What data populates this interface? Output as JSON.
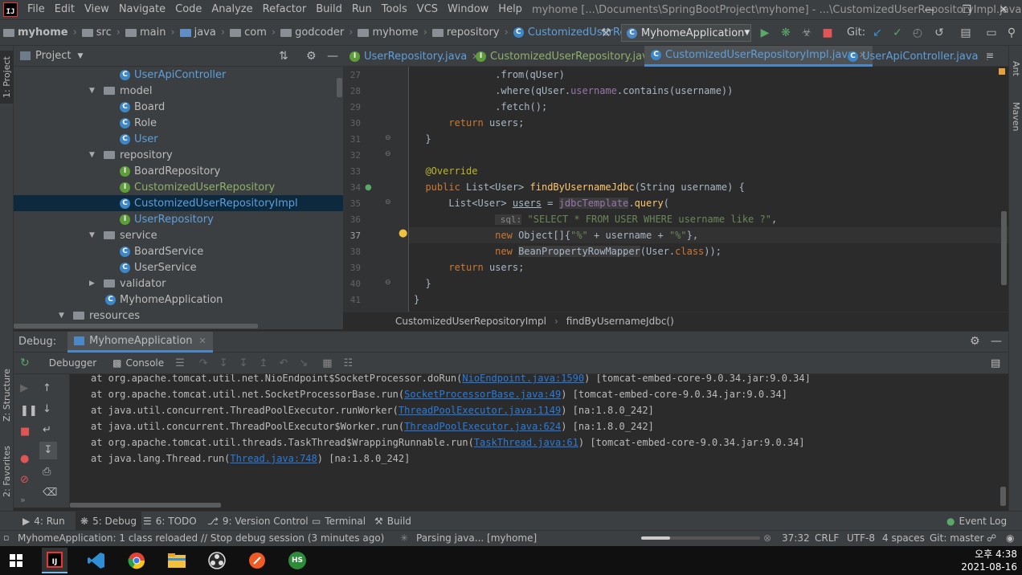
{
  "menubar": {
    "items": [
      "File",
      "Edit",
      "View",
      "Navigate",
      "Code",
      "Analyze",
      "Refactor",
      "Build",
      "Run",
      "Tools",
      "VCS",
      "Window",
      "Help"
    ],
    "title": "myhome [...\\Documents\\SpringBootProject\\myhome] - ...\\CustomizedUserRepositoryImpl.java"
  },
  "navbar": {
    "crumbs": [
      "myhome",
      "src",
      "main",
      "java",
      "com",
      "godcoder",
      "myhome",
      "repository",
      "CustomizedUserRepositoryImpl"
    ],
    "run_config": "MyhomeApplication",
    "git_label": "Git:"
  },
  "left_stripe": {
    "project": "1: Project",
    "structure": "Z: Structure",
    "favorites": "2: Favorites"
  },
  "right_stripe": {
    "ant": "Ant",
    "maven": "Maven"
  },
  "project_panel": {
    "title": "Project",
    "tree": [
      {
        "label": "UserApiController",
        "kind": "class",
        "color": "blue"
      },
      {
        "label": "model",
        "kind": "folder",
        "expanded": true
      },
      {
        "label": "Board",
        "kind": "class"
      },
      {
        "label": "Role",
        "kind": "class"
      },
      {
        "label": "User",
        "kind": "class",
        "color": "blue"
      },
      {
        "label": "repository",
        "kind": "folder",
        "expanded": true
      },
      {
        "label": "BoardRepository",
        "kind": "interface"
      },
      {
        "label": "CustomizedUserRepository",
        "kind": "interface",
        "color": "green"
      },
      {
        "label": "CustomizedUserRepositoryImpl",
        "kind": "class",
        "color": "blue",
        "selected": true
      },
      {
        "label": "UserRepository",
        "kind": "interface",
        "color": "blue"
      },
      {
        "label": "service",
        "kind": "folder",
        "expanded": true
      },
      {
        "label": "BoardService",
        "kind": "class"
      },
      {
        "label": "UserService",
        "kind": "class"
      },
      {
        "label": "validator",
        "kind": "folder",
        "expanded": false
      },
      {
        "label": "MyhomeApplication",
        "kind": "class"
      },
      {
        "label": "resources",
        "kind": "folder",
        "expanded": true
      }
    ]
  },
  "editor": {
    "tabs": [
      {
        "label": "UserRepository.java",
        "kind": "interface"
      },
      {
        "label": "CustomizedUserRepository.java",
        "kind": "interface"
      },
      {
        "label": "CustomizedUserRepositoryImpl.java",
        "kind": "class",
        "active": true
      },
      {
        "label": "UserApiController.java",
        "kind": "class"
      }
    ],
    "line_numbers": [
      "27",
      "28",
      "29",
      "30",
      "31",
      "32",
      "33",
      "34",
      "35",
      "36",
      "37",
      "38",
      "39",
      "40",
      "41"
    ],
    "breadcrumb": [
      "CustomizedUserRepositoryImpl",
      "findByUsernameJdbc()"
    ]
  },
  "debug": {
    "label": "Debug:",
    "session_tab": "MyhomeApplication",
    "debugger_tab": "Debugger",
    "console_tab": "Console",
    "console_lines": [
      {
        "pre": "at org.apache.tomcat.util.net.NioEndpoint$SocketProcessor.doRun(",
        "link": "NioEndpoint.java:1590",
        "post": ") [tomcat-embed-core-9.0.34.jar:9.0.34]"
      },
      {
        "pre": "at org.apache.tomcat.util.net.SocketProcessorBase.run(",
        "link": "SocketProcessorBase.java:49",
        "post": ") [tomcat-embed-core-9.0.34.jar:9.0.34]"
      },
      {
        "pre": "at java.util.concurrent.ThreadPoolExecutor.runWorker(",
        "link": "ThreadPoolExecutor.java:1149",
        "post": ") [na:1.8.0_242]"
      },
      {
        "pre": "at java.util.concurrent.ThreadPoolExecutor$Worker.run(",
        "link": "ThreadPoolExecutor.java:624",
        "post": ") [na:1.8.0_242]"
      },
      {
        "pre": "at org.apache.tomcat.util.threads.TaskThread$WrappingRunnable.run(",
        "link": "TaskThread.java:61",
        "post": ") [tomcat-embed-core-9.0.34.jar:9.0.34]"
      },
      {
        "pre": "at java.lang.Thread.run(",
        "link": "Thread.java:748",
        "post": ") [na:1.8.0_242]"
      }
    ]
  },
  "toolwindows": {
    "run": "4: Run",
    "debug": "5: Debug",
    "todo": "6: TODO",
    "vcs": "9: Version Control",
    "terminal": "Terminal",
    "build": "Build",
    "event_log": "Event Log"
  },
  "status": {
    "message": "MyhomeApplication: 1 class reloaded // Stop debug session (3 minutes ago)",
    "task": "Parsing java... [myhome]",
    "position": "37:32",
    "line_sep": "CRLF",
    "encoding": "UTF-8",
    "indent": "4 spaces",
    "branch": "Git: master"
  },
  "taskbar": {
    "time": "오후 4:38",
    "date": "2021-08-16",
    "hs": "HS"
  },
  "colors": {
    "accent": "#4a88c7",
    "selection": "#0d293e",
    "keyword": "#cc7832",
    "string": "#6a8759",
    "annotation": "#bbb529",
    "function": "#ffc66d"
  }
}
